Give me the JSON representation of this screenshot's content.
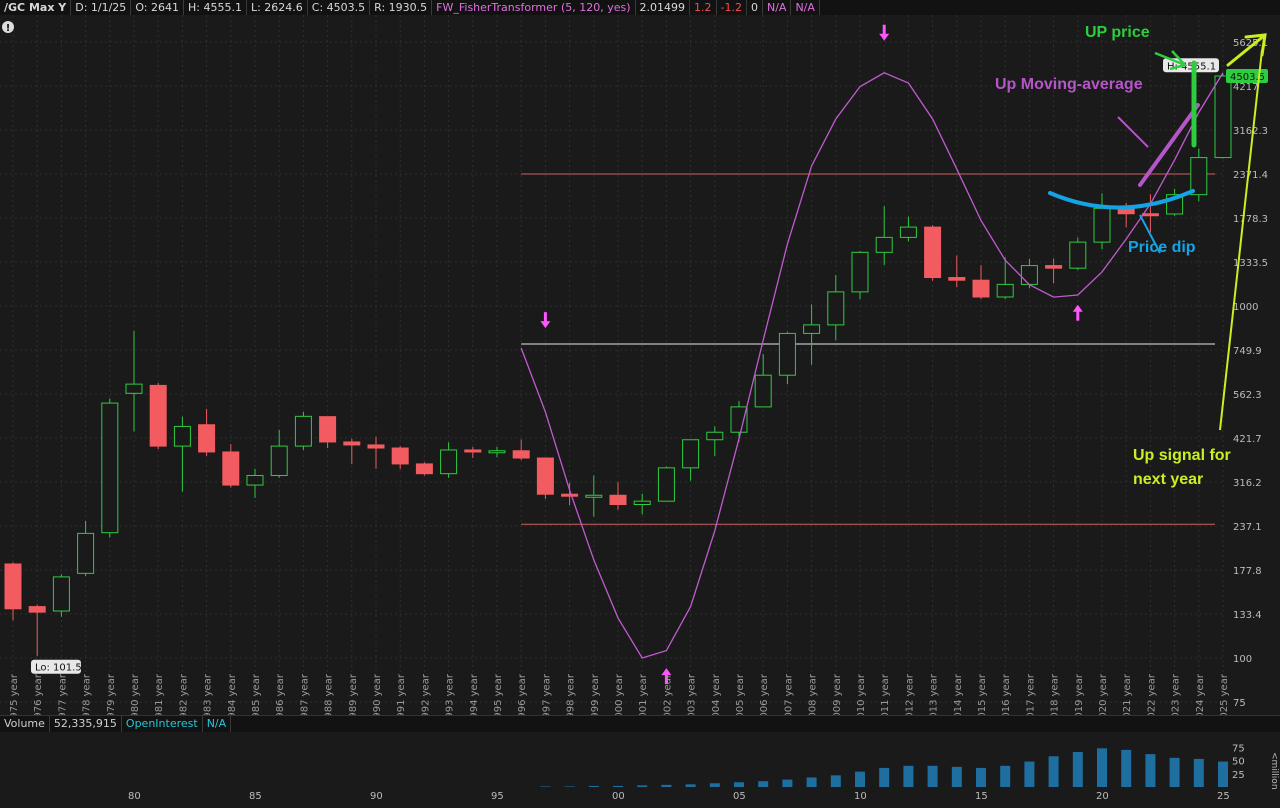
{
  "header": {
    "symbol": "/GC Max Y",
    "date": "D: 1/1/25",
    "open": "O: 2641",
    "high": "H: 4555.1",
    "low": "L: 2624.6",
    "close": "C: 4503.5",
    "range": "R: 1930.5",
    "study": "FW_FisherTransformer (5, 120, yes)",
    "study_val": "2.01499",
    "v1": "1.2",
    "v2": "-1.2",
    "v3": "0",
    "na1": "N/A",
    "na2": "N/A"
  },
  "volume_header": {
    "label": "Volume",
    "value": "52,335,915",
    "oi_label": "OpenInterest",
    "oi_value": "N/A"
  },
  "colors": {
    "bg": "#1a1a1a",
    "up": "#2ecc40",
    "down": "#f25c60",
    "ma": "#c05bd0",
    "volume": "#1e6fa0",
    "grid": "#2e2e2e",
    "annot_green": "#2ecc40",
    "annot_purple": "#b455c8",
    "annot_blue": "#16a3e6",
    "annot_yellow": "#c8f020",
    "arrow_pink": "#ff55ff"
  },
  "chart_data": {
    "type": "candlestick",
    "title": "/GC Max Y",
    "y_scale": "log",
    "y_ticks": [
      "5625.1",
      "4217",
      "3162.3",
      "2371.4",
      "1778.3",
      "1333.5",
      "1000",
      "749.9",
      "562.3",
      "421.7",
      "316.2",
      "237.1",
      "177.8",
      "133.4",
      "100",
      "75"
    ],
    "x_tick_labels": [
      "80",
      "85",
      "90",
      "95",
      "00",
      "05",
      "10",
      "15",
      "20",
      "25"
    ],
    "last_price_label": "4503.5",
    "high_label": "H: 4555.1",
    "low_label": "Lo: 101.5",
    "candles": [
      {
        "year": "1975 year",
        "o": 185,
        "h": 187,
        "l": 128,
        "c": 138
      },
      {
        "year": "1976 year",
        "o": 140,
        "h": 142,
        "l": 101.5,
        "c": 135
      },
      {
        "year": "1977 year",
        "o": 136,
        "h": 173,
        "l": 131,
        "c": 170
      },
      {
        "year": "1978 year",
        "o": 174,
        "h": 245,
        "l": 171,
        "c": 226
      },
      {
        "year": "1979 year",
        "o": 227,
        "h": 546,
        "l": 220,
        "c": 530
      },
      {
        "year": "1980 year",
        "o": 565,
        "h": 850,
        "l": 440,
        "c": 600
      },
      {
        "year": "1981 year",
        "o": 595,
        "h": 605,
        "l": 392,
        "c": 400
      },
      {
        "year": "1982 year",
        "o": 400,
        "h": 485,
        "l": 297,
        "c": 455
      },
      {
        "year": "1983 year",
        "o": 460,
        "h": 510,
        "l": 375,
        "c": 385
      },
      {
        "year": "1984 year",
        "o": 385,
        "h": 405,
        "l": 305,
        "c": 310
      },
      {
        "year": "1985 year",
        "o": 310,
        "h": 345,
        "l": 285,
        "c": 330
      },
      {
        "year": "1986 year",
        "o": 330,
        "h": 445,
        "l": 325,
        "c": 400
      },
      {
        "year": "1987 year",
        "o": 400,
        "h": 500,
        "l": 390,
        "c": 486
      },
      {
        "year": "1988 year",
        "o": 485,
        "h": 485,
        "l": 395,
        "c": 411
      },
      {
        "year": "1989 year",
        "o": 411,
        "h": 420,
        "l": 356,
        "c": 403
      },
      {
        "year": "1990 year",
        "o": 403,
        "h": 425,
        "l": 345,
        "c": 395
      },
      {
        "year": "1991 year",
        "o": 395,
        "h": 400,
        "l": 344,
        "c": 356
      },
      {
        "year": "1992 year",
        "o": 356,
        "h": 360,
        "l": 330,
        "c": 334
      },
      {
        "year": "1993 year",
        "o": 334,
        "h": 410,
        "l": 325,
        "c": 390
      },
      {
        "year": "1994 year",
        "o": 390,
        "h": 398,
        "l": 370,
        "c": 386
      },
      {
        "year": "1995 year",
        "o": 383,
        "h": 398,
        "l": 372,
        "c": 388
      },
      {
        "year": "1996 year",
        "o": 388,
        "h": 418,
        "l": 365,
        "c": 370
      },
      {
        "year": "1997 year",
        "o": 370,
        "h": 370,
        "l": 283,
        "c": 292
      },
      {
        "year": "1998 year",
        "o": 292,
        "h": 315,
        "l": 272,
        "c": 290
      },
      {
        "year": "1999 year",
        "o": 290,
        "h": 330,
        "l": 252,
        "c": 290
      },
      {
        "year": "2000 year",
        "o": 290,
        "h": 316,
        "l": 264,
        "c": 273
      },
      {
        "year": "2001 year",
        "o": 273,
        "h": 293,
        "l": 256,
        "c": 279
      },
      {
        "year": "2002 year",
        "o": 279,
        "h": 350,
        "l": 278,
        "c": 347
      },
      {
        "year": "2003 year",
        "o": 347,
        "h": 417,
        "l": 319,
        "c": 417
      },
      {
        "year": "2004 year",
        "o": 417,
        "h": 455,
        "l": 375,
        "c": 438
      },
      {
        "year": "2005 year",
        "o": 438,
        "h": 537,
        "l": 411,
        "c": 517
      },
      {
        "year": "2006 year",
        "o": 517,
        "h": 730,
        "l": 517,
        "c": 636
      },
      {
        "year": "2007 year",
        "o": 636,
        "h": 845,
        "l": 600,
        "c": 836
      },
      {
        "year": "2008 year",
        "o": 836,
        "h": 1011,
        "l": 681,
        "c": 884
      },
      {
        "year": "2009 year",
        "o": 884,
        "h": 1226,
        "l": 800,
        "c": 1097
      },
      {
        "year": "2010 year",
        "o": 1097,
        "h": 1432,
        "l": 1045,
        "c": 1421
      },
      {
        "year": "2011 year",
        "o": 1421,
        "h": 1923,
        "l": 1308,
        "c": 1567
      },
      {
        "year": "2012 year",
        "o": 1567,
        "h": 1795,
        "l": 1527,
        "c": 1676
      },
      {
        "year": "2013 year",
        "o": 1676,
        "h": 1697,
        "l": 1180,
        "c": 1205
      },
      {
        "year": "2014 year",
        "o": 1205,
        "h": 1392,
        "l": 1131,
        "c": 1184
      },
      {
        "year": "2015 year",
        "o": 1184,
        "h": 1307,
        "l": 1046,
        "c": 1061
      },
      {
        "year": "2016 year",
        "o": 1061,
        "h": 1375,
        "l": 1046,
        "c": 1152
      },
      {
        "year": "2017 year",
        "o": 1152,
        "h": 1362,
        "l": 1123,
        "c": 1303
      },
      {
        "year": "2018 year",
        "o": 1303,
        "h": 1365,
        "l": 1160,
        "c": 1281
      },
      {
        "year": "2019 year",
        "o": 1281,
        "h": 1566,
        "l": 1266,
        "c": 1519
      },
      {
        "year": "2020 year",
        "o": 1519,
        "h": 2089,
        "l": 1451,
        "c": 1895
      },
      {
        "year": "2021 year",
        "o": 1895,
        "h": 1962,
        "l": 1673,
        "c": 1829
      },
      {
        "year": "2022 year",
        "o": 1829,
        "h": 2078,
        "l": 1618,
        "c": 1826
      },
      {
        "year": "2023 year",
        "o": 1826,
        "h": 2152,
        "l": 1805,
        "c": 2072
      },
      {
        "year": "2024 year",
        "o": 2072,
        "h": 2802,
        "l": 1984,
        "c": 2641
      },
      {
        "year": "2025 year",
        "o": 2641,
        "h": 4555.1,
        "l": 2624.6,
        "c": 4503.5
      }
    ],
    "moving_average": [
      {
        "year": "1996 year",
        "v": 760
      },
      {
        "year": "1997 year",
        "v": 500
      },
      {
        "year": "1998 year",
        "v": 300
      },
      {
        "year": "1999 year",
        "v": 190
      },
      {
        "year": "2000 year",
        "v": 130
      },
      {
        "year": "2001 year",
        "v": 100
      },
      {
        "year": "2002 year",
        "v": 105
      },
      {
        "year": "2003 year",
        "v": 140
      },
      {
        "year": "2004 year",
        "v": 230
      },
      {
        "year": "2005 year",
        "v": 420
      },
      {
        "year": "2006 year",
        "v": 800
      },
      {
        "year": "2007 year",
        "v": 1500
      },
      {
        "year": "2008 year",
        "v": 2500
      },
      {
        "year": "2009 year",
        "v": 3400
      },
      {
        "year": "2010 year",
        "v": 4200
      },
      {
        "year": "2011 year",
        "v": 4600
      },
      {
        "year": "2012 year",
        "v": 4300
      },
      {
        "year": "2013 year",
        "v": 3400
      },
      {
        "year": "2014 year",
        "v": 2450
      },
      {
        "year": "2015 year",
        "v": 1750
      },
      {
        "year": "2016 year",
        "v": 1350
      },
      {
        "year": "2017 year",
        "v": 1150
      },
      {
        "year": "2018 year",
        "v": 1060
      },
      {
        "year": "2019 year",
        "v": 1075
      },
      {
        "year": "2020 year",
        "v": 1250
      },
      {
        "year": "2021 year",
        "v": 1550
      },
      {
        "year": "2022 year",
        "v": 1950
      },
      {
        "year": "2023 year",
        "v": 2600
      },
      {
        "year": "2024 year",
        "v": 3550
      },
      {
        "year": "2025 year",
        "v": 4600
      }
    ],
    "horizontal_lines": [
      {
        "value": 2371.4,
        "color": "#d06060"
      },
      {
        "value": 780,
        "color": "#e8e8e8"
      },
      {
        "value": 240,
        "color": "#d06060"
      }
    ],
    "arrows": [
      {
        "year": "1997 year",
        "dir": "down",
        "value": 900
      },
      {
        "year": "2011 year",
        "dir": "down",
        "value": 5900
      },
      {
        "year": "2002 year",
        "dir": "up",
        "value": 90
      },
      {
        "year": "2019 year",
        "dir": "up",
        "value": 970
      }
    ],
    "volume_ticks": [
      "75",
      "50",
      "25"
    ],
    "volume_unit": "<millions>",
    "volume": [
      0,
      0,
      0,
      0,
      0,
      0,
      0,
      0,
      0,
      0,
      0,
      0,
      0,
      0,
      0,
      0,
      0,
      0,
      0,
      0,
      0,
      0,
      1,
      1,
      2,
      2,
      3,
      4,
      5,
      7,
      9,
      11,
      14,
      18,
      22,
      29,
      36,
      40,
      40,
      38,
      36,
      40,
      48,
      58,
      66,
      73,
      70,
      62,
      55,
      53,
      48
    ]
  },
  "annotations": {
    "up_price": "UP price",
    "up_ma": "Up Moving-average",
    "price_dip": "Price dip",
    "signal_line1": "Up signal for",
    "signal_line2": "next year"
  }
}
